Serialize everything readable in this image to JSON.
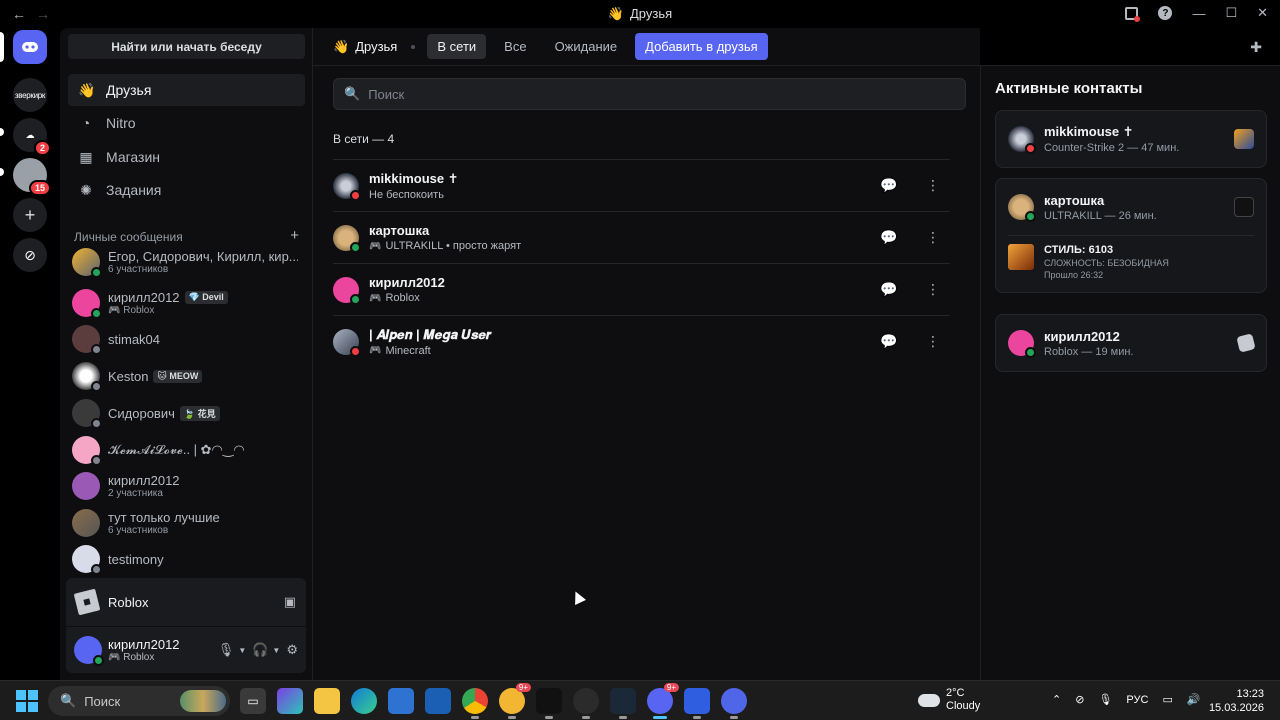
{
  "window": {
    "title": "Друзья",
    "back": "←",
    "forward": "→"
  },
  "rail": {
    "server_text": "зверкирк",
    "badge_1": "2",
    "badge_2": "15"
  },
  "sidebar": {
    "search_label": "Найти или начать беседу",
    "nav": [
      {
        "label": "Друзья",
        "icon": "friends-icon"
      },
      {
        "label": "Nitro",
        "icon": "nitro-icon"
      },
      {
        "label": "Магазин",
        "icon": "shop-icon"
      },
      {
        "label": "Задания",
        "icon": "quests-icon"
      }
    ],
    "dm_header": "Личные сообщения",
    "dms": [
      {
        "name": "Егор, Сидорович, Кирилл, кир...",
        "sub": "6 участников"
      },
      {
        "name": "кирилл2012",
        "tag": "💎 Devil",
        "sub": "🎮 Roblox"
      },
      {
        "name": "stimak04",
        "sub": ""
      },
      {
        "name": "Keston",
        "tag": "🐱 MEOW",
        "sub": ""
      },
      {
        "name": "Сидорович",
        "tag": "🍃 花見",
        "sub": ""
      },
      {
        "name": "𝓚𝓮𝓶𝓐𝓲𝓛𝓸𝓿𝓮.. | ✿◠‿◠",
        "sub": ""
      },
      {
        "name": "кирилл2012",
        "sub": "2 участника"
      },
      {
        "name": "тут только лучшие",
        "sub": "6 участников"
      },
      {
        "name": "testimony",
        "sub": ""
      }
    ],
    "activity": {
      "label": "Roblox"
    },
    "user": {
      "name": "кирилл2012",
      "sub": "🎮 Roblox"
    }
  },
  "main": {
    "crumb": "Друзья",
    "tabs": [
      "В сети",
      "Все",
      "Ожидание"
    ],
    "add_friend": "Добавить в друзья",
    "search_placeholder": "Поиск",
    "online_count": "В сети — 4",
    "friends": [
      {
        "name": "mikkimouse ✝",
        "sub": "Не беспокоить",
        "game": false
      },
      {
        "name": "картошка",
        "sub": "ULTRAKILL • просто жарят",
        "game": true
      },
      {
        "name": "кирилл2012",
        "sub": "Roblox",
        "game": true
      },
      {
        "name": "| 𝑨𝒍𝒑𝒆𝒏 | 𝑴𝒆𝒈𝒂 𝑼𝒔𝒆𝒓",
        "sub": "Minecraft",
        "game": true
      }
    ]
  },
  "active": {
    "title": "Активные контакты",
    "cards": [
      {
        "name": "mikkimouse ✝",
        "sub": "Counter-Strike 2 — 47 мин."
      },
      {
        "name": "картошка",
        "sub": "ULTRAKILL — 26 мин.",
        "detail_1": "СТИЛЬ: 6103",
        "detail_2": "СЛОЖНОСТЬ: БЕЗОБИДНАЯ",
        "detail_3": "Прошло 26:32"
      },
      {
        "name": "кирилл2012",
        "sub": "Roblox — 19 мин."
      }
    ]
  },
  "taskbar": {
    "search_label": "Поиск",
    "badge_a": "9+",
    "badge_b": "9+",
    "temp": "2°C",
    "weather": "Cloudy",
    "lang": "РУС",
    "time": "13:23",
    "date": "15.03.2026"
  },
  "colors": {
    "accent": "#5865f2",
    "online": "#23a55a",
    "dnd": "#f23f43",
    "offline": "#80848e"
  }
}
